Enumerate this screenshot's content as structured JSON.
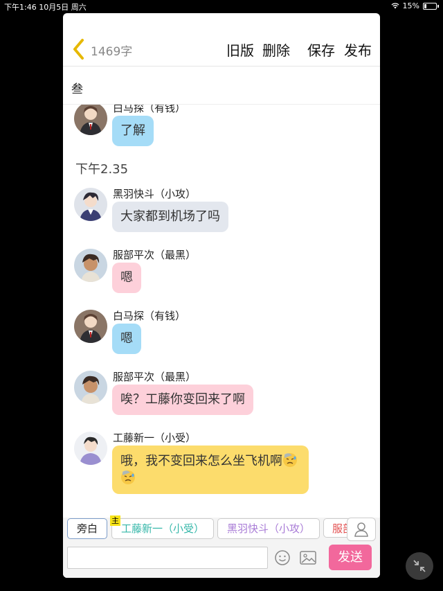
{
  "status_bar": {
    "time_date": "下午1:46  10月5日 周六",
    "battery_text": "15%"
  },
  "header": {
    "word_count": "1469字",
    "buttons": {
      "old_version": "旧版",
      "delete": "删除",
      "save": "保存",
      "publish": "发布"
    }
  },
  "chapter_title": "叁",
  "timestamp": "下午2.35",
  "messages": [
    {
      "name": "白马探（有钱）",
      "text": "了解",
      "color": "#a5dcf7"
    },
    {
      "name": "黑羽快斗（小攻）",
      "text": "大家都到机场了吗",
      "color": "#e3e7ee"
    },
    {
      "name": "服部平次（最黑）",
      "text": "嗯",
      "color": "#fdd0da"
    },
    {
      "name": "白马探（有钱）",
      "text": "嗯",
      "color": "#a5dcf7"
    },
    {
      "name": "服部平次（最黑）",
      "text": "唉？工藤你变回来了啊",
      "color": "#fdd0da"
    },
    {
      "name": "工藤新一（小受）",
      "text": "哦，我不变回来怎么坐飞机啊",
      "emoji": "downcast-sweat-face",
      "color": "#fcdc6c"
    }
  ],
  "characters": [
    {
      "label": "旁白",
      "selected": true
    },
    {
      "label": "工藤新一（小受）",
      "badge": "主"
    },
    {
      "label": "黑羽快斗（小攻）"
    },
    {
      "label": "服部平次（最黑）"
    }
  ],
  "input": {
    "value": "",
    "placeholder": ""
  },
  "send_label": "发送",
  "colors": {
    "accent": "#f2689c",
    "back_arrow": "#e6b800"
  }
}
